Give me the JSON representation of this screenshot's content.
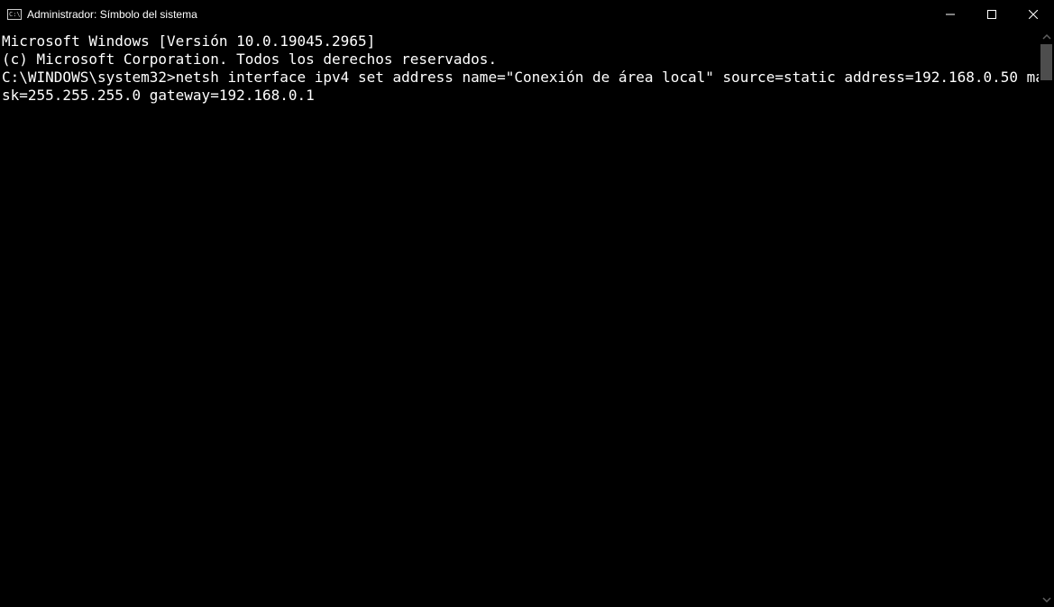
{
  "window": {
    "title": "Administrador: Símbolo del sistema",
    "controls": {
      "minimize_label": "Minimize",
      "maximize_label": "Maximize",
      "close_label": "Close"
    }
  },
  "terminal": {
    "banner_line1": "Microsoft Windows [Versión 10.0.19045.2965]",
    "banner_line2": "(c) Microsoft Corporation. Todos los derechos reservados.",
    "blank": "",
    "prompt": "C:\\WINDOWS\\system32>",
    "command": "netsh interface ipv4 set address name=\"Conexión de área local\" source=static address=192.168.0.50 mask=255.255.255.0 gateway=192.168.0.1"
  }
}
